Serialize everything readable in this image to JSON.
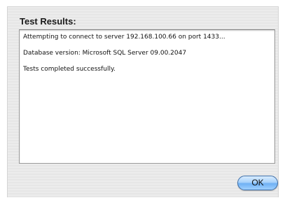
{
  "dialog": {
    "title": "Test Results:",
    "results": [
      "Attempting to connect to server 192.168.100.66 on port 1433...",
      "Database version: Microsoft SQL Server 09.00.2047",
      "Tests completed successfully."
    ],
    "ok_label": "OK"
  },
  "colors": {
    "accent": "#6fb1f4",
    "panel_background": "#ececec",
    "text": "#111111"
  }
}
